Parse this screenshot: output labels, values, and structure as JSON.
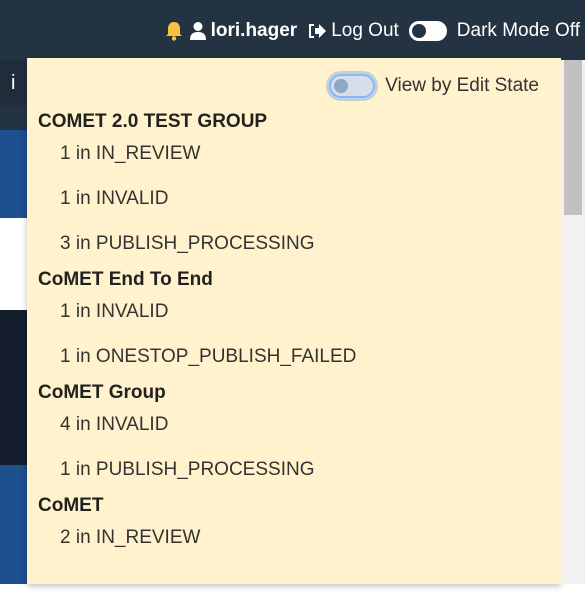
{
  "navbar": {
    "username": "lori.hager",
    "logout_label": "Log Out",
    "dark_mode_label": "Dark Mode Off"
  },
  "background": {
    "partial_letter": "i"
  },
  "dropdown": {
    "view_toggle_label": "View by Edit State",
    "groups": [
      {
        "title": "COMET 2.0 TEST GROUP",
        "items": [
          "1 in IN_REVIEW",
          "1 in INVALID",
          "3 in PUBLISH_PROCESSING"
        ]
      },
      {
        "title": "CoMET End To End",
        "items": [
          "1 in INVALID",
          "1 in ONESTOP_PUBLISH_FAILED"
        ]
      },
      {
        "title": "CoMET Group",
        "items": [
          "4 in INVALID",
          "1 in PUBLISH_PROCESSING"
        ]
      },
      {
        "title": "CoMET",
        "items": [
          "2 in IN_REVIEW"
        ]
      }
    ]
  },
  "colors": {
    "navbar_bg": "#243342",
    "dropdown_bg": "#fff2cc",
    "bell": "#f6c23e"
  },
  "icons": {
    "bell": "bell-icon",
    "user": "user-icon",
    "logout": "logout-icon"
  }
}
